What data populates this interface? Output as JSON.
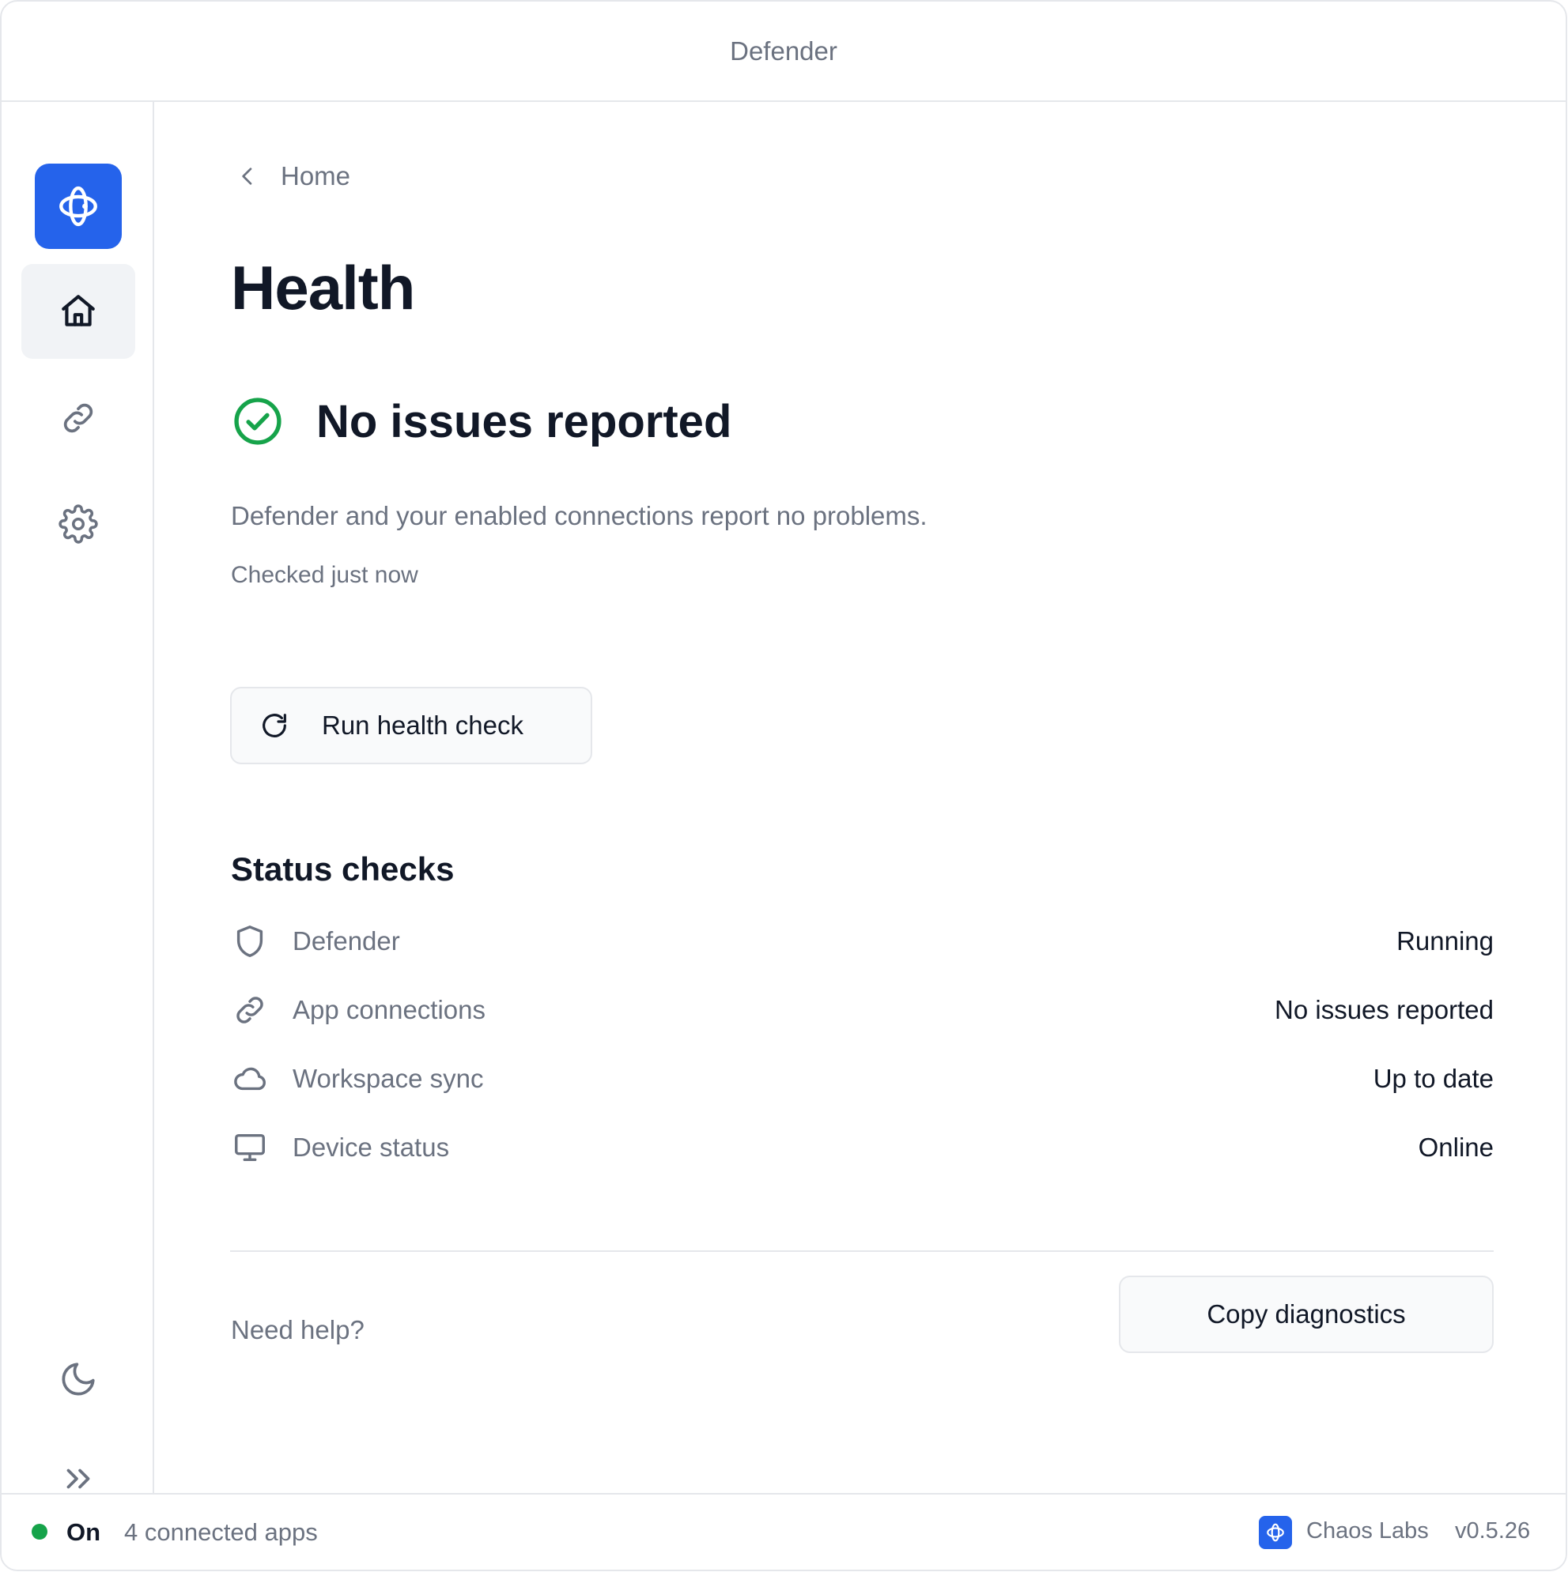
{
  "window": {
    "title": "Defender"
  },
  "sidebar": {
    "items": [
      {
        "name": "home",
        "icon": "home-icon",
        "active": true
      },
      {
        "name": "connections",
        "icon": "link-icon",
        "active": false
      },
      {
        "name": "settings",
        "icon": "gear-icon",
        "active": false
      }
    ],
    "bottom": [
      {
        "name": "theme",
        "icon": "moon-icon"
      },
      {
        "name": "expand",
        "icon": "chevrons-right-icon"
      }
    ]
  },
  "breadcrumb": {
    "label": "Home"
  },
  "page": {
    "title": "Health",
    "status_title": "No issues reported",
    "description": "Defender and your enabled connections report no problems.",
    "checked": "Checked just now",
    "run_button": "Run health check"
  },
  "status_checks": {
    "title": "Status checks",
    "rows": [
      {
        "icon": "shield-icon",
        "label": "Defender",
        "value": "Running"
      },
      {
        "icon": "link-icon",
        "label": "App connections",
        "value": "No issues reported"
      },
      {
        "icon": "cloud-icon",
        "label": "Workspace sync",
        "value": "Up to date"
      },
      {
        "icon": "monitor-icon",
        "label": "Device status",
        "value": "Online"
      }
    ]
  },
  "footer": {
    "help": "Need help?",
    "copy_button": "Copy diagnostics"
  },
  "statusbar": {
    "state": "On",
    "apps": "4 connected apps",
    "brand": "Chaos Labs",
    "version": "v0.5.26"
  },
  "colors": {
    "accent": "#2563eb",
    "success": "#16a34a",
    "muted_text": "#6b7280",
    "text": "#111827",
    "border": "#e5e7eb"
  }
}
